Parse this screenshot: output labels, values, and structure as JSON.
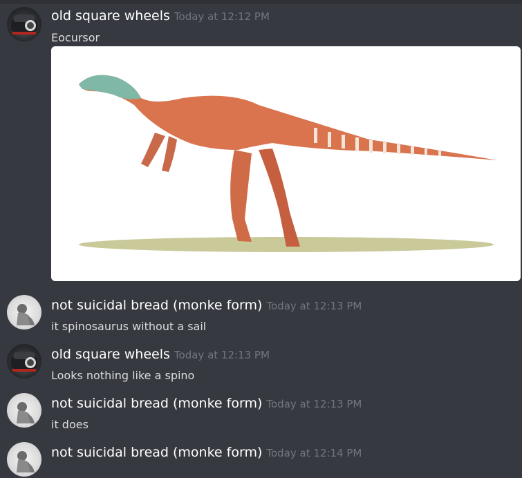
{
  "messages": [
    {
      "username": "old square wheels",
      "timestamp": "Today at 12:12 PM",
      "content": "Eocursor",
      "avatar_icon": "car-avatar-icon",
      "has_image": true
    },
    {
      "username": "not suicidal bread (monke form)",
      "timestamp": "Today at 12:13 PM",
      "content": "it spinosaurus without a sail",
      "avatar_icon": "monkey-avatar-icon"
    },
    {
      "username": "old square wheels",
      "timestamp": "Today at 12:13 PM",
      "content": "Looks nothing like a spino",
      "avatar_icon": "car-avatar-icon"
    },
    {
      "username": "not suicidal bread (monke form)",
      "timestamp": "Today at 12:13 PM",
      "content": "it does",
      "avatar_icon": "monkey-avatar-icon"
    },
    {
      "username": "not suicidal bread (monke form)",
      "timestamp": "Today at 12:14 PM",
      "content": "",
      "avatar_icon": "monkey-avatar-icon"
    }
  ],
  "image": {
    "subject": "dinosaur-illustration",
    "background": "#ffffff"
  },
  "colors": {
    "background": "#36393f",
    "username": "#ffffff",
    "timestamp": "#72767d",
    "text": "#dcddde"
  }
}
